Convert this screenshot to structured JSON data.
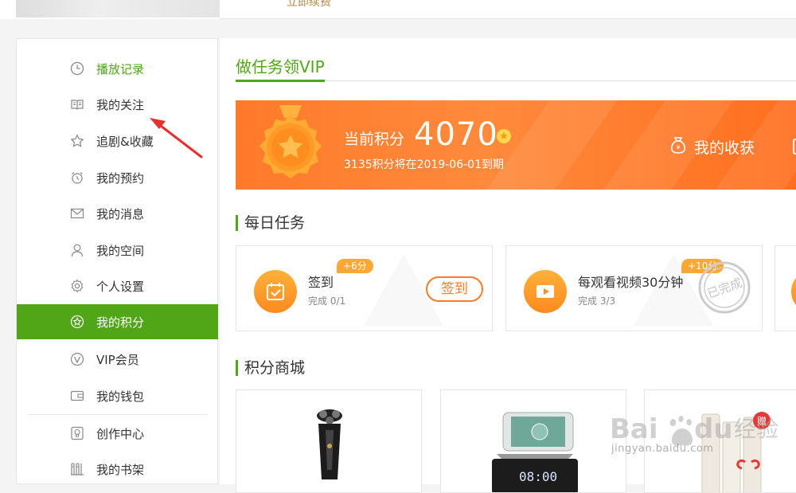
{
  "top": {
    "cut_text": "立即续费"
  },
  "sidebar": {
    "items": [
      {
        "label": "播放记录",
        "icon": "clock-icon",
        "state": "highlight"
      },
      {
        "label": "我的关注",
        "icon": "book-icon"
      },
      {
        "label": "追剧&收藏",
        "icon": "star-icon"
      },
      {
        "label": "我的预约",
        "icon": "alarm-clock-icon"
      },
      {
        "label": "我的消息",
        "icon": "mail-icon"
      },
      {
        "label": "我的空间",
        "icon": "user-icon"
      },
      {
        "label": "个人设置",
        "icon": "gear-icon"
      },
      {
        "label": "我的积分",
        "icon": "points-star-icon",
        "state": "active"
      },
      {
        "label": "VIP会员",
        "icon": "vip-icon"
      },
      {
        "label": "我的钱包",
        "icon": "wallet-icon"
      },
      {
        "label": "创作中心",
        "icon": "lightbulb-icon"
      },
      {
        "label": "我的书架",
        "icon": "bookshelf-icon"
      }
    ]
  },
  "main": {
    "title": "做任务领VIP",
    "banner": {
      "score_label": "当前积分",
      "score_value": "4070",
      "expire_note": "3135积分将在2019-06-01到期",
      "harvest_label": "我的收获"
    },
    "daily_title": "每日任务",
    "tasks": [
      {
        "name": "签到",
        "progress": "完成 0/1",
        "reward": "+6分",
        "button": "签到",
        "icon": "calendar-check-icon"
      },
      {
        "name": "每观看视频30分钟",
        "progress": "完成 3/3",
        "reward": "+10分",
        "stamp": "已完成",
        "icon": "play-icon"
      }
    ],
    "mall_title": "积分商城",
    "products": [
      {
        "name": "shaver",
        "icon": "shaver-icon"
      },
      {
        "name": "clock-speaker",
        "icon": "clock-speaker-icon",
        "display": "08:00"
      },
      {
        "name": "gift-bottles",
        "icon": "gift-bottles-icon",
        "badge": "赠"
      }
    ]
  },
  "watermark": {
    "brand": "Baidu经验",
    "url": "jingyan.baidu.com"
  },
  "colors": {
    "green": "#50a617",
    "orange": "#ff7a2a",
    "gold": "#ffa733"
  }
}
